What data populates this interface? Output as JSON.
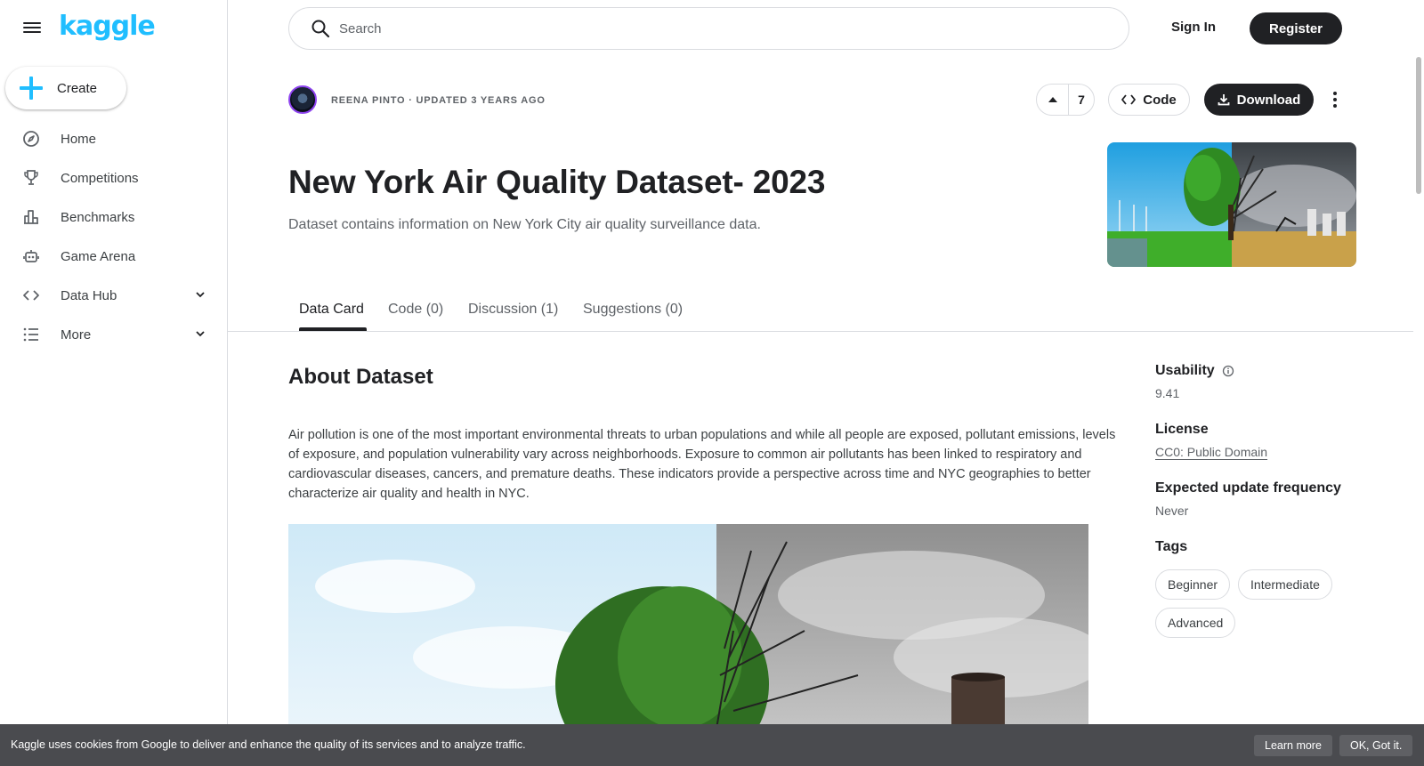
{
  "sidebar": {
    "logo": "kaggle",
    "create_label": "Create",
    "items": [
      {
        "label": "Home",
        "icon": "compass-icon"
      },
      {
        "label": "Competitions",
        "icon": "trophy-icon"
      },
      {
        "label": "Benchmarks",
        "icon": "bar-chart-icon"
      },
      {
        "label": "Game Arena",
        "icon": "robot-icon"
      },
      {
        "label": "Data Hub",
        "icon": "code-brackets-icon"
      },
      {
        "label": "More",
        "icon": "list-icon"
      }
    ]
  },
  "topbar": {
    "search_placeholder": "Search",
    "sign_in": "Sign In",
    "register": "Register"
  },
  "dataset": {
    "byline": "REENA PINTO · UPDATED 3 YEARS AGO",
    "upvotes": "7",
    "code_label": "Code",
    "download_label": "Download",
    "title": "New York Air Quality Dataset- 2023",
    "subtitle": "Dataset contains information on New York City air quality surveillance data."
  },
  "tabs": [
    {
      "label": "Data Card",
      "active": true
    },
    {
      "label": "Code (0)"
    },
    {
      "label": "Discussion (1)"
    },
    {
      "label": "Suggestions (0)"
    }
  ],
  "about": {
    "heading": "About Dataset",
    "description": "Air pollution is one of the most important environmental threats to urban populations and while all people are exposed, pollutant emissions, levels of exposure, and population vulnerability vary across neighborhoods. Exposure to common air pollutants has been linked to respiratory and cardiovascular diseases, cancers, and premature deaths. These indicators provide a perspective across time and NYC geographies to better characterize air quality and health in NYC."
  },
  "rail": {
    "usability_label": "Usability",
    "usability_value": "9.41",
    "license_label": "License",
    "license_value": "CC0: Public Domain",
    "frequency_label": "Expected update frequency",
    "frequency_value": "Never",
    "tags_label": "Tags",
    "tags": [
      "Beginner",
      "Intermediate",
      "Advanced"
    ]
  },
  "cookie": {
    "text": "Kaggle uses cookies from Google to deliver and enhance the quality of its services and to analyze traffic.",
    "learn_more": "Learn more",
    "ok": "OK, Got it."
  },
  "colors": {
    "brand": "#20beff",
    "primary_dark": "#202124",
    "avatar_ring": "#8e44ef",
    "cookie_bg": "#4a4b4f"
  }
}
